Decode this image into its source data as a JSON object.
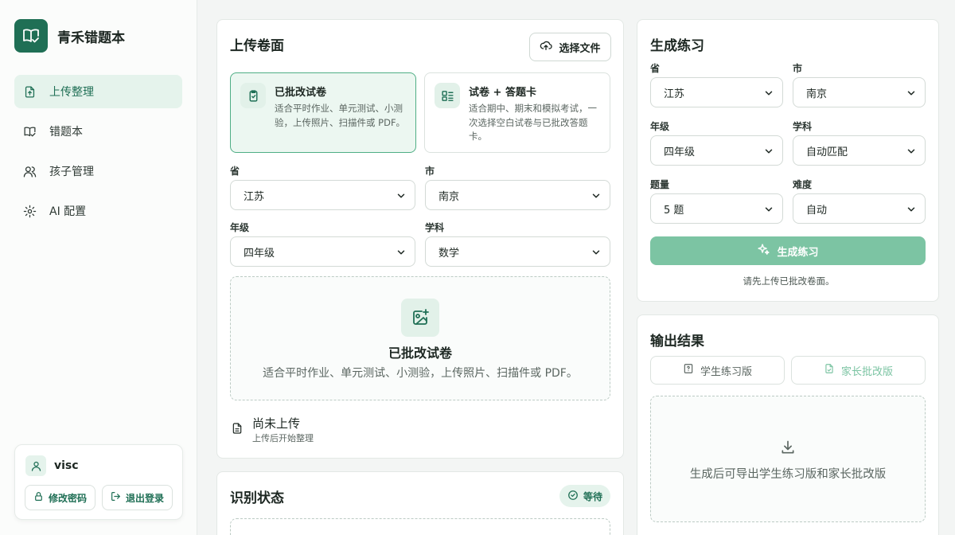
{
  "app": {
    "name": "青禾错题本",
    "logo_icon": "book-check-icon"
  },
  "colors": {
    "brand": "#1f6f55",
    "accent": "#4fae85",
    "primary_disabled": "#7cc4a3"
  },
  "sidebar": {
    "items": [
      {
        "label": "上传整理",
        "icon": "upload-file-icon",
        "active": true
      },
      {
        "label": "错题本",
        "icon": "book-icon",
        "active": false
      },
      {
        "label": "孩子管理",
        "icon": "users-icon",
        "active": false
      },
      {
        "label": "AI 配置",
        "icon": "gear-icon",
        "active": false
      }
    ],
    "user": {
      "name": "visc",
      "change_password": "修改密码",
      "logout": "退出登录"
    }
  },
  "upload": {
    "title": "上传卷面",
    "choose_file": "选择文件",
    "modes": [
      {
        "title": "已批改试卷",
        "desc": "适合平时作业、单元测试、小测验，上传照片、扫描件或 PDF。",
        "icon": "clipboard-check-icon",
        "active": true
      },
      {
        "title": "试卷 + 答题卡",
        "desc": "适合期中、期末和模拟考试，一次选择空白试卷与已批改答题卡。",
        "icon": "list-icon",
        "active": false
      }
    ],
    "labels": {
      "province": "省",
      "city": "市",
      "grade": "年级",
      "subject": "学科"
    },
    "values": {
      "province": "江苏",
      "city": "南京",
      "grade": "四年级",
      "subject": "数学"
    },
    "dropzone": {
      "title": "已批改试卷",
      "desc": "适合平时作业、单元测试、小测验，上传照片、扫描件或 PDF。"
    },
    "status": {
      "title": "尚未上传",
      "sub": "上传后开始整理"
    }
  },
  "recognition": {
    "title": "识别状态",
    "badge": "等待"
  },
  "practice": {
    "title": "生成练习",
    "labels": {
      "province": "省",
      "city": "市",
      "grade": "年级",
      "subject": "学科",
      "count": "题量",
      "difficulty": "难度"
    },
    "values": {
      "province": "江苏",
      "city": "南京",
      "grade": "四年级",
      "subject": "自动匹配",
      "count": "5 题",
      "difficulty": "自动"
    },
    "button": "生成练习",
    "hint": "请先上传已批改卷面。"
  },
  "output": {
    "title": "输出结果",
    "student_tab": "学生练习版",
    "parent_tab": "家长批改版",
    "empty": "生成后可导出学生练习版和家长批改版"
  }
}
